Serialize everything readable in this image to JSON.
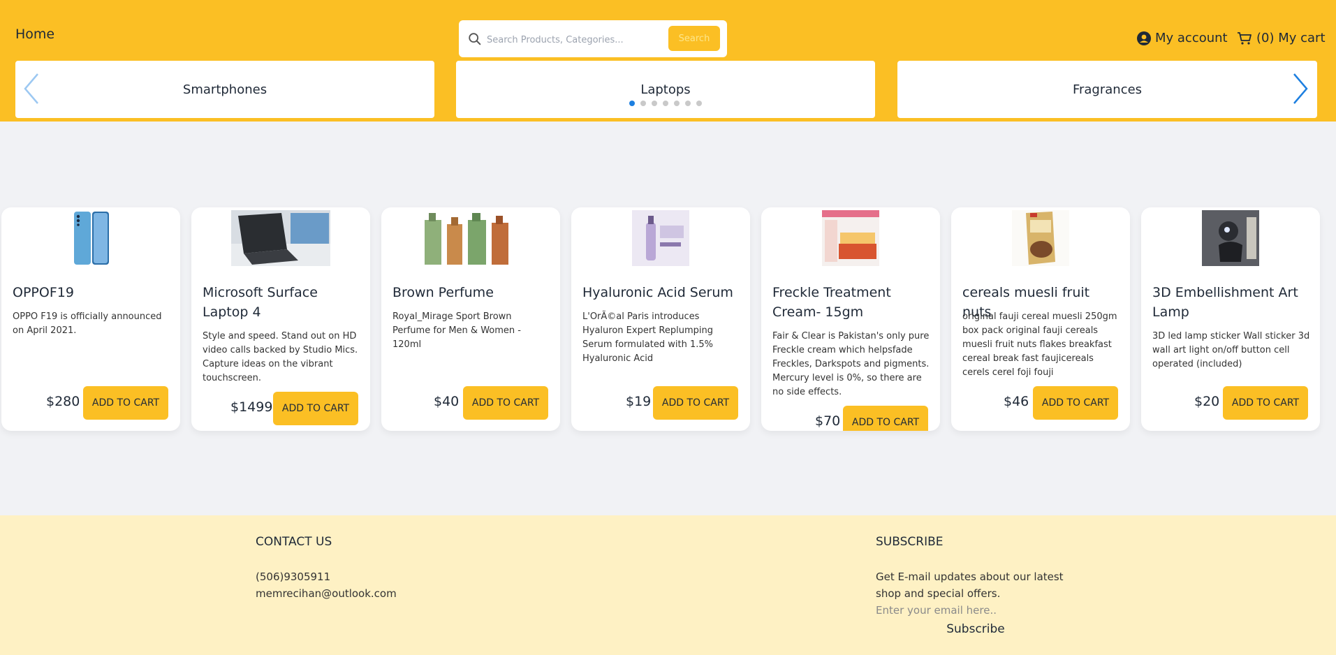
{
  "header": {
    "home_label": "Home",
    "search": {
      "placeholder": "Search Products, Categories...",
      "button_label": "Search"
    },
    "account_label": "My account",
    "cart_label": "(0) My cart"
  },
  "categories": [
    "Smartphones",
    "Laptops",
    "Fragrances"
  ],
  "carousel": {
    "dot_count": 7,
    "active_index": 0
  },
  "products": [
    {
      "title": "OPPOF19",
      "description": "OPPO F19 is officially announced on April 2021.",
      "price": "$280",
      "button": "ADD TO CART"
    },
    {
      "title": "Microsoft Surface Laptop 4",
      "description": "Style and speed. Stand out on HD video calls backed by Studio Mics. Capture ideas on the vibrant touchscreen.",
      "price": "$1499",
      "button": "ADD TO CART"
    },
    {
      "title": "Brown Perfume",
      "description": "Royal_Mirage Sport Brown Perfume for Men & Women - 120ml",
      "price": "$40",
      "button": "ADD TO CART"
    },
    {
      "title": "Hyaluronic Acid Serum",
      "description": "L'OrÃ©al Paris introduces Hyaluron Expert Replumping Serum formulated with 1.5% Hyaluronic Acid",
      "price": "$19",
      "button": "ADD TO CART"
    },
    {
      "title": "Freckle Treatment Cream- 15gm",
      "description": "Fair & Clear is Pakistan's only pure Freckle cream which helpsfade Freckles, Darkspots and pigments. Mercury level is 0%, so there are no side effects.",
      "price": "$70",
      "button": "ADD TO CART"
    },
    {
      "title": "cereals muesli fruit nuts",
      "description": "original fauji cereal muesli 250gm box pack original fauji cereals muesli fruit nuts flakes breakfast cereal break fast faujicereals cerels cerel foji fouji",
      "price": "$46",
      "button": "ADD TO CART"
    },
    {
      "title": "3D Embellishment Art Lamp",
      "description": "3D led lamp sticker Wall sticker 3d wall art light on/off button cell operated (included)",
      "price": "$20",
      "button": "ADD TO CART"
    }
  ],
  "footer": {
    "contact": {
      "title": "CONTACT US",
      "phone": "(506)9305911",
      "email": "memrecihan@outlook.com"
    },
    "subscribe": {
      "title": "SUBSCRIBE",
      "line1": "Get E-mail updates about our latest",
      "line2": "shop and special offers.",
      "email_placeholder": "Enter your email here..",
      "button_label": "Subscribe"
    }
  },
  "colors": {
    "header_bg": "#fbbf24",
    "footer_bg": "#fef1c4",
    "page_bg": "#f1f2f5",
    "accent_blue": "#1d7fe0"
  }
}
